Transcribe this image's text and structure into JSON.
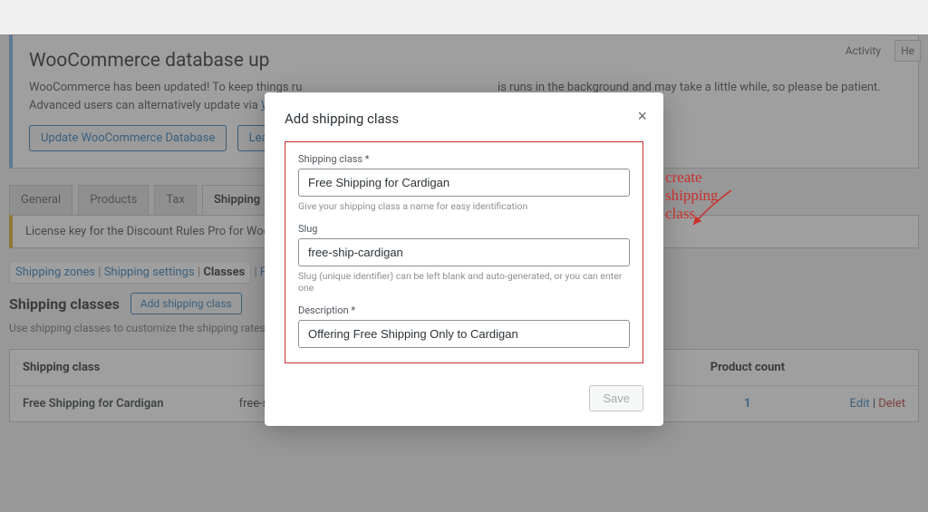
{
  "top": {
    "activity": "Activity",
    "help": "He"
  },
  "notice": {
    "title": "WooCommerce database up",
    "body_pre": "WooCommerce has been updated! To keep things ru",
    "body_mid": "is runs in the background and may take a little while, so please be patient.",
    "body_adv_pre": "Advanced users can alternatively update via ",
    "body_adv_link": "WP CL",
    "btn_update": "Update WooCommerce Database",
    "btn_learn": "Learn mo"
  },
  "tabs": [
    "General",
    "Products",
    "Tax",
    "Shipping"
  ],
  "active_tab": "Shipping",
  "license_bar": "License key for the Discount Rules Pro for WooComm",
  "subsub": {
    "zones": "Shipping zones",
    "settings": "Shipping settings",
    "classes": "Classes",
    "free": "Free ship"
  },
  "heading": {
    "title": "Shipping classes",
    "add_btn": "Add shipping class",
    "desc": "Use shipping classes to customize the shipping rates for diff"
  },
  "table": {
    "cols": [
      "Shipping class",
      "",
      "",
      "Product count",
      ""
    ],
    "rows": [
      {
        "name": "Free Shipping for Cardigan",
        "slug": "free-ship-cardigan",
        "desc": "Offering Free Shipping Only to Cardigan",
        "count": "1",
        "edit": "Edit",
        "delete": "Delet"
      }
    ]
  },
  "modal": {
    "title": "Add shipping class",
    "fields": {
      "class_label": "Shipping class *",
      "class_value": "Free Shipping for Cardigan",
      "class_help": "Give your shipping class a name for easy identification",
      "slug_label": "Slug",
      "slug_value": "free-ship-cardigan",
      "slug_help": "Slug (unique identifier) can be left blank and auto-generated, or you can enter one",
      "desc_label": "Description *",
      "desc_value": "Offering Free Shipping Only to Cardigan"
    },
    "save": "Save"
  },
  "annotation": "create shipping class"
}
